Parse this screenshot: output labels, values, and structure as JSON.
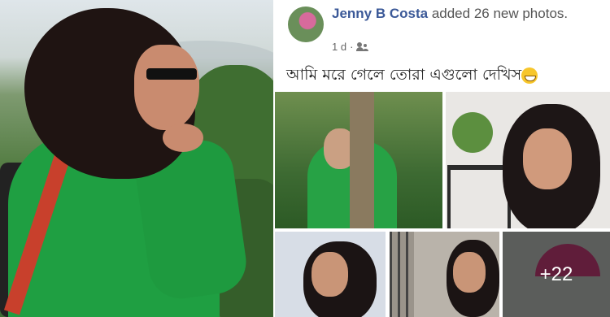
{
  "post": {
    "author": "Jenny B Costa",
    "action": " added 26 new photos.",
    "time": "1 d",
    "separator": "·",
    "privacy_icon": "friends-icon",
    "text": "আমি মরে গেলে তোরা এগুলো দেখিস",
    "emoji": "grinning-face-emoji",
    "more_photos": "+22"
  }
}
